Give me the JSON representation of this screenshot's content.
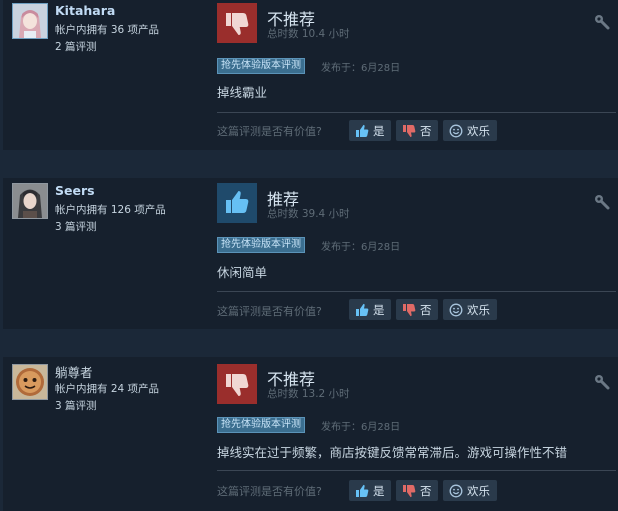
{
  "colors": {
    "page_bg": "#1b2838",
    "card_bg": "#16202d",
    "not_recommended_icon_bg": "#9a2e2c",
    "recommended_icon_bg": "#1f4a6b",
    "badge_bg": "#3b6e8f",
    "button_bg": "#2a3a4b"
  },
  "helpful_question": "这篇评测是否有价值?",
  "buttons": {
    "yes": "是",
    "no": "否",
    "funny": "欢乐"
  },
  "reviews": [
    {
      "user": {
        "name": "Kitahara",
        "products": "帐户内拥有 36 项产品",
        "reviews": "2 篇评测"
      },
      "verdict": "不推荐",
      "verdict_icon": "thumbs-down-icon",
      "hours": "总时数 10.4 小时",
      "badge": "抢先体验版本评测",
      "posted": "发布于：6月28日",
      "content": "掉线霸业"
    },
    {
      "user": {
        "name": "Seers",
        "products": "帐户内拥有 126 项产品",
        "reviews": "3 篇评测"
      },
      "verdict": "推荐",
      "verdict_icon": "thumbs-up-icon",
      "hours": "总时数 39.4 小时",
      "badge": "抢先体验版本评测",
      "posted": "发布于：6月28日",
      "content": "休闲简单"
    },
    {
      "user": {
        "name": "躺尊者",
        "products": "帐户内拥有 24 项产品",
        "reviews": "3 篇评测"
      },
      "verdict": "不推荐",
      "verdict_icon": "thumbs-down-icon",
      "hours": "总时数 13.2 小时",
      "badge": "抢先体验版本评测",
      "posted": "发布于：6月28日",
      "content": "掉线实在过于频繁，商店按键反馈常常滞后。游戏可操作性不错"
    }
  ]
}
